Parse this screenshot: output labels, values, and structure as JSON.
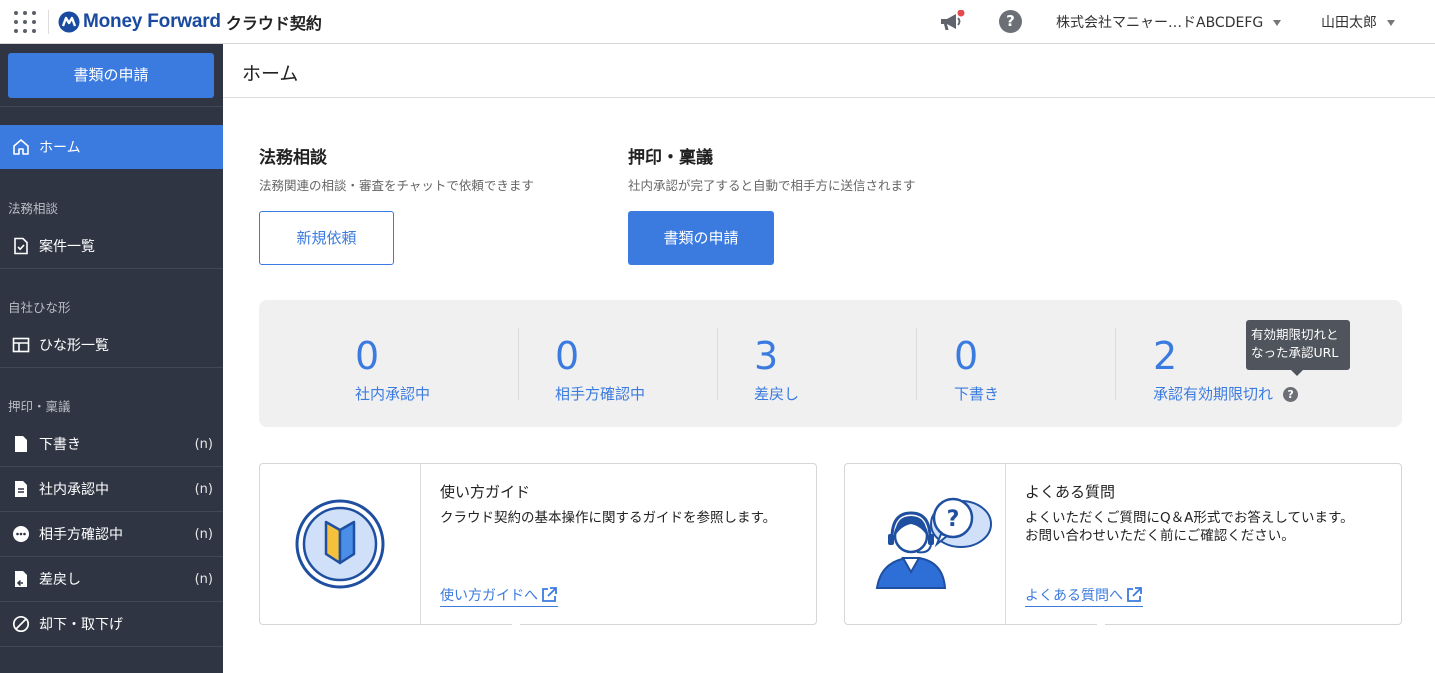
{
  "header": {
    "logo_text": "Money Forward",
    "logo_sub": "クラウド契約",
    "company": "株式会社マニャー…ドABCDEFG",
    "user": "山田太郎"
  },
  "sidebar": {
    "apply_button": "書類の申請",
    "home": "ホーム",
    "categories": [
      "法務相談",
      "自社ひな形",
      "押印・稟議"
    ],
    "items": [
      {
        "label": "案件一覧",
        "count": ""
      },
      {
        "label": "ひな形一覧",
        "count": ""
      },
      {
        "label": "下書き",
        "count": "(n)"
      },
      {
        "label": "社内承認中",
        "count": "(n)"
      },
      {
        "label": "相手方確認中",
        "count": "(n)"
      },
      {
        "label": "差戻し",
        "count": "(n)"
      },
      {
        "label": "却下・取下げ",
        "count": ""
      }
    ]
  },
  "page": {
    "title": "ホーム"
  },
  "legal": {
    "title": "法務相談",
    "desc": "法務関連の相談・審査をチャットで依頼できます",
    "button": "新規依頼"
  },
  "stamp": {
    "title": "押印・稟議",
    "desc": "社内承認が完了すると自動で相手方に送信されます",
    "button": "書類の申請"
  },
  "stats": [
    {
      "value": "0",
      "label": "社内承認中"
    },
    {
      "value": "0",
      "label": "相手方確認中"
    },
    {
      "value": "3",
      "label": "差戻し"
    },
    {
      "value": "0",
      "label": "下書き"
    },
    {
      "value": "2",
      "label": "承認有効期限切れ"
    }
  ],
  "tooltip": {
    "line1": "有効期限切れと",
    "line2": "なった承認URL"
  },
  "cards": {
    "guide": {
      "title": "使い方ガイド",
      "desc": "クラウド契約の基本操作に関するガイドを参照します。",
      "link": "使い方ガイドへ"
    },
    "faq": {
      "title": "よくある質問",
      "desc_line1": "よくいただくご質問にQ＆A形式でお答えしています。",
      "desc_line2": "お問い合わせいただく前にご確認ください。",
      "link": "よくある質問へ"
    }
  },
  "colors": {
    "primary": "#3b7be0",
    "sidebar_bg": "#2f3542",
    "brand": "#1a4ba0"
  }
}
